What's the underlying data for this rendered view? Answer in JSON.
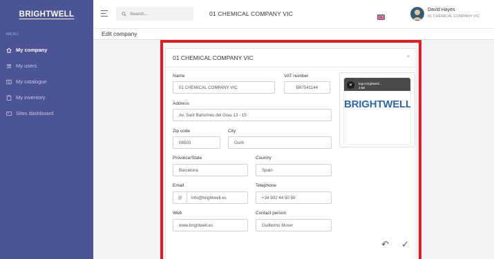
{
  "brand": "BRIGHTWELL",
  "sidebar": {
    "menu_label": "MENU",
    "items": [
      {
        "label": "My company",
        "icon": "home-icon",
        "active": true
      },
      {
        "label": "My users",
        "icon": "users-icon",
        "active": false
      },
      {
        "label": "My catalogue",
        "icon": "book-icon",
        "active": false
      },
      {
        "label": "My inventory",
        "icon": "clipboard-icon",
        "active": false
      },
      {
        "label": "Sites dashboard",
        "icon": "dashboard-icon",
        "active": false
      }
    ]
  },
  "topbar": {
    "search_placeholder": "Search...",
    "company": "01 CHEMICAL COMPANY VIC",
    "user_name": "David Hayes",
    "user_company": "01 CHEMICAL COMPANY VIC"
  },
  "page": {
    "title": "Edit company"
  },
  "modal": {
    "title": "01 CHEMICAL COMPANY VIC",
    "close": "×",
    "fields": {
      "name": {
        "label": "Name",
        "value": "01 CHEMICAL COMPANY VIC"
      },
      "vat": {
        "label": "VAT number",
        "value": "B67541144"
      },
      "address": {
        "label": "Address",
        "value": "Av. Sant Bartomeu del Grau 13 - 15"
      },
      "zip": {
        "label": "Zip code",
        "value": "08503"
      },
      "city": {
        "label": "City",
        "value": "Gurb"
      },
      "province": {
        "label": "Province/State",
        "value": "Barcelona"
      },
      "country": {
        "label": "Country",
        "value": "Spain"
      },
      "email": {
        "label": "Email",
        "value": "info@brightwell.es",
        "prefix": "@"
      },
      "telephone": {
        "label": "Telephone",
        "value": "+34 902 44 50 50"
      },
      "web": {
        "label": "Web",
        "value": "www.brightwell.es"
      },
      "contact": {
        "label": "Contact person",
        "value": "Guillermo Moser"
      }
    },
    "logo": {
      "filename": "logo-brightwell...",
      "size": "3 kB",
      "brand": "BRIGHTWELL"
    },
    "actions": {
      "back": "↶",
      "confirm": "✓"
    }
  },
  "colors": {
    "sidebar": "#4b5595",
    "highlight": "#e01b24",
    "logo_brand": "#2a68b3"
  }
}
